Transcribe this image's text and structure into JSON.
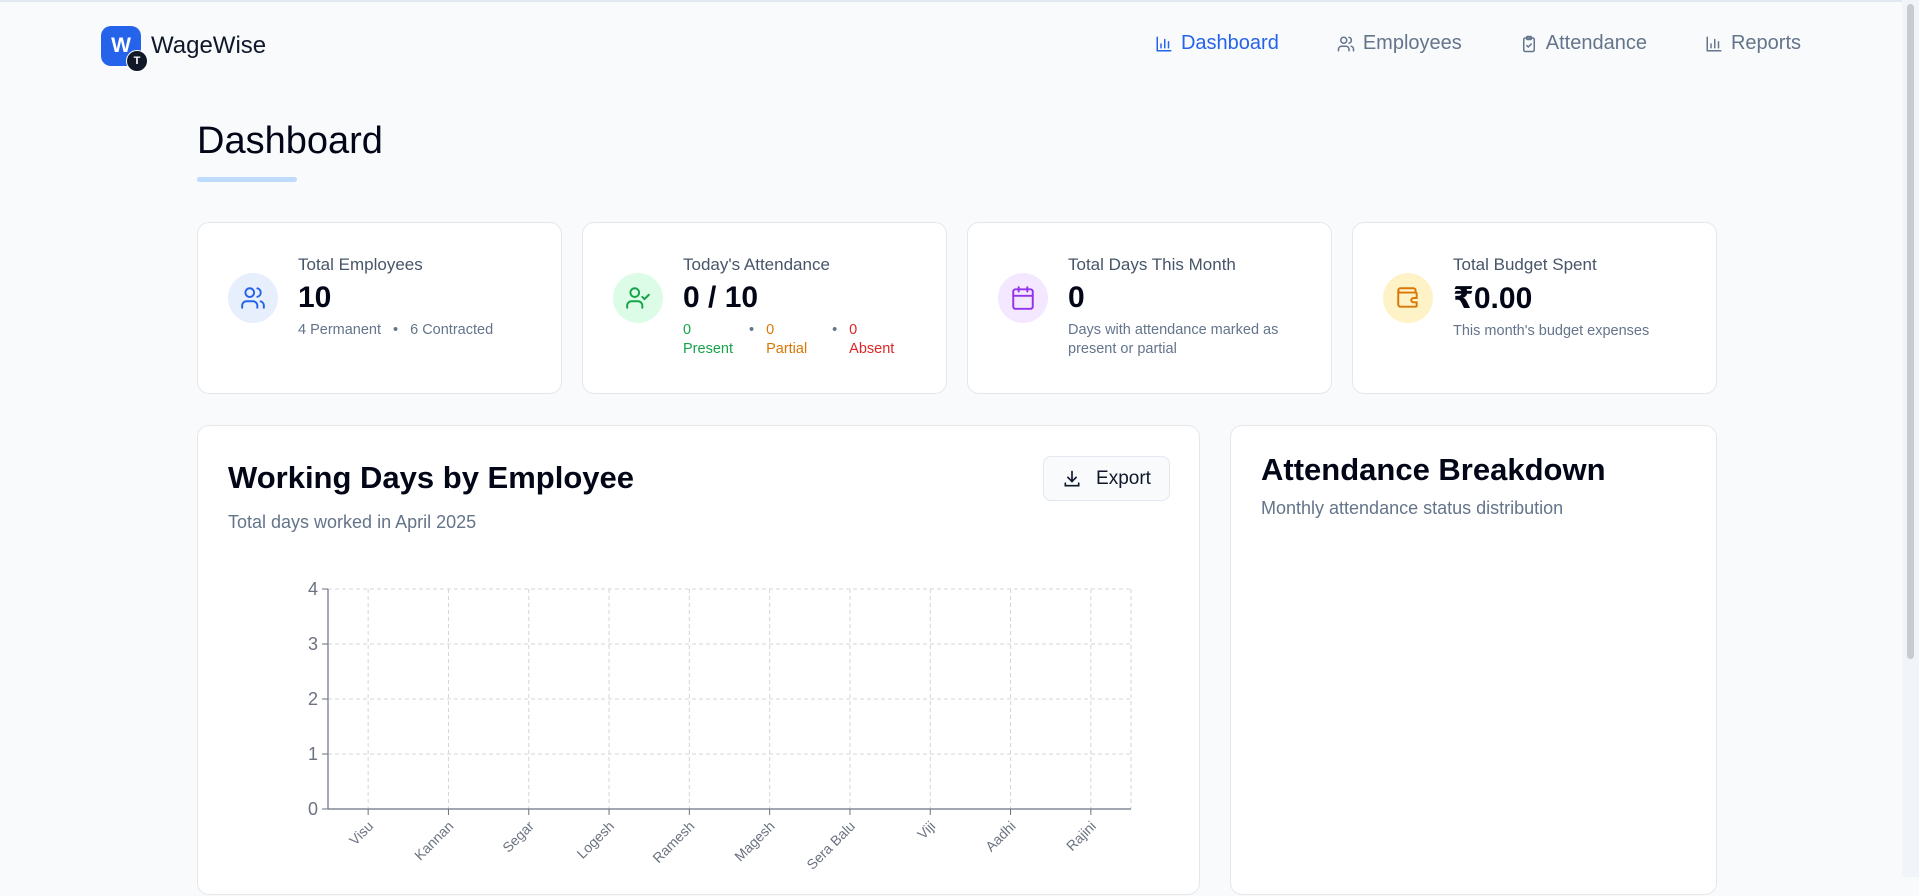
{
  "brand": {
    "logo_letter": "W",
    "logo_badge": "T",
    "name": "WageWise"
  },
  "nav": [
    {
      "label": "Dashboard",
      "icon": "bar-chart-icon",
      "active": true
    },
    {
      "label": "Employees",
      "icon": "users-icon",
      "active": false
    },
    {
      "label": "Attendance",
      "icon": "clipboard-check-icon",
      "active": false
    },
    {
      "label": "Reports",
      "icon": "bar-chart-icon",
      "active": false
    }
  ],
  "page": {
    "title": "Dashboard"
  },
  "stats": {
    "employees": {
      "label": "Total Employees",
      "value": "10",
      "permanent": "4 Permanent",
      "contracted": "6 Contracted",
      "icon": "users-icon"
    },
    "attendance": {
      "label": "Today's Attendance",
      "value": "0 / 10",
      "icon": "user-check-icon",
      "present_count": "0",
      "present_label": "Present",
      "partial_count": "0",
      "partial_label": "Partial",
      "absent_count": "0",
      "absent_label": "Absent"
    },
    "days": {
      "label": "Total Days This Month",
      "value": "0",
      "sub": "Days with attendance marked as present or partial",
      "icon": "calendar-icon"
    },
    "budget": {
      "label": "Total Budget Spent",
      "value": "₹0.00",
      "sub": "This month's budget expenses",
      "icon": "wallet-icon"
    }
  },
  "working_days": {
    "title": "Working Days by Employee",
    "subtitle": "Total days worked in April 2025",
    "export_label": "Export"
  },
  "breakdown": {
    "title": "Attendance Breakdown",
    "subtitle": "Monthly attendance status distribution"
  },
  "colors": {
    "accent": "#2563eb",
    "present": "#16a34a",
    "partial": "#d97706",
    "absent": "#dc2626",
    "purple": "#9333ea"
  },
  "chart_data": {
    "type": "bar",
    "categories": [
      "Visu",
      "Kannan",
      "Segar",
      "Logesh",
      "Ramesh",
      "Magesh",
      "Sera Balu",
      "Viji",
      "Aadhi",
      "Rajini"
    ],
    "values": [
      0,
      0,
      0,
      0,
      0,
      0,
      0,
      0,
      0,
      0
    ],
    "yticks": [
      0,
      1,
      2,
      3,
      4
    ],
    "ylim": [
      0,
      4
    ],
    "grid": true,
    "xlabel": "",
    "ylabel": ""
  }
}
